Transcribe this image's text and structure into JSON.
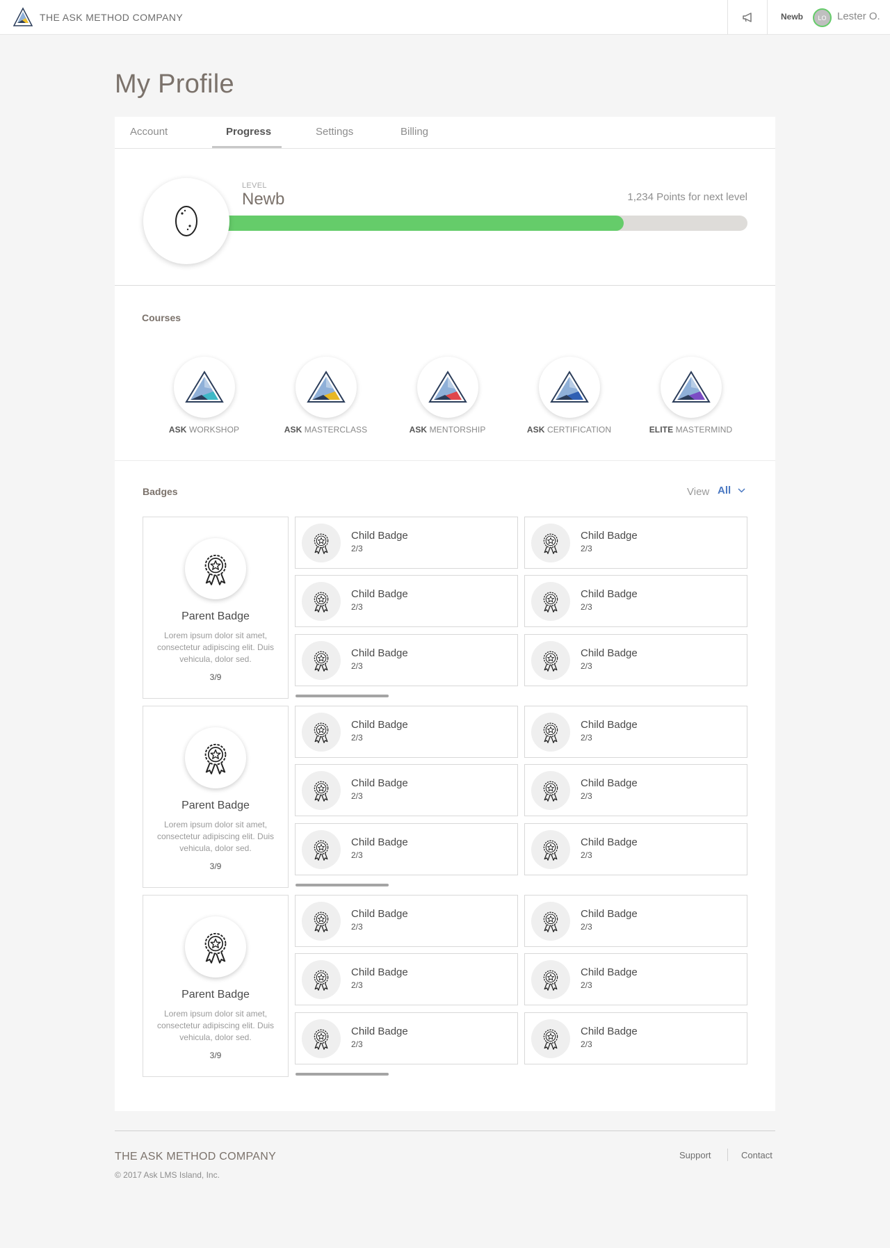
{
  "header": {
    "brand": "THE ASK METHOD COMPANY",
    "announcement_icon": "megaphone-icon",
    "user_level": "Newb",
    "avatar_initials": "LO",
    "user_name": "Lester O."
  },
  "page": {
    "title": "My Profile"
  },
  "tabs": [
    {
      "label": "Account",
      "active": false
    },
    {
      "label": "Progress",
      "active": true
    },
    {
      "label": "Settings",
      "active": false
    },
    {
      "label": "Billing",
      "active": false
    }
  ],
  "level": {
    "caption": "LEVEL",
    "name": "Newb",
    "icon": "egg-icon",
    "points_text": "1,234 Points for next level",
    "progress_fraction": 0.766
  },
  "courses": {
    "label": "Courses",
    "items": [
      {
        "prefix": "ASK",
        "name": "WORKSHOP",
        "accent": "#3fb8c6"
      },
      {
        "prefix": "ASK",
        "name": "MASTERCLASS",
        "accent": "#e8b723"
      },
      {
        "prefix": "ASK",
        "name": "MENTORSHIP",
        "accent": "#e0474c"
      },
      {
        "prefix": "ASK",
        "name": "CERTIFICATION",
        "accent": "#2f5fb3"
      },
      {
        "prefix": "ELITE",
        "name": "MASTERMIND",
        "accent": "#7b4cc4"
      }
    ]
  },
  "badges": {
    "label": "Badges",
    "view_label": "View",
    "view_value": "All",
    "groups": [
      {
        "parent": {
          "name": "Parent Badge",
          "description": "Lorem ipsum dolor sit amet, consectetur adipiscing elit. Duis vehicula, dolor sed.",
          "count": "3/9"
        },
        "children": [
          {
            "name": "Child Badge",
            "count": "2/3"
          },
          {
            "name": "Child Badge",
            "count": "2/3"
          },
          {
            "name": "Child Badge",
            "count": "2/3"
          },
          {
            "name": "Child Badge",
            "count": "2/3"
          },
          {
            "name": "Child Badge",
            "count": "2/3"
          },
          {
            "name": "Child Badge",
            "count": "2/3"
          }
        ]
      },
      {
        "parent": {
          "name": "Parent Badge",
          "description": "Lorem ipsum dolor sit amet, consectetur adipiscing elit. Duis vehicula, dolor sed.",
          "count": "3/9"
        },
        "children": [
          {
            "name": "Child Badge",
            "count": "2/3"
          },
          {
            "name": "Child Badge",
            "count": "2/3"
          },
          {
            "name": "Child Badge",
            "count": "2/3"
          },
          {
            "name": "Child Badge",
            "count": "2/3"
          },
          {
            "name": "Child Badge",
            "count": "2/3"
          },
          {
            "name": "Child Badge",
            "count": "2/3"
          }
        ]
      },
      {
        "parent": {
          "name": "Parent Badge",
          "description": "Lorem ipsum dolor sit amet, consectetur adipiscing elit. Duis vehicula, dolor sed.",
          "count": "3/9"
        },
        "children": [
          {
            "name": "Child Badge",
            "count": "2/3"
          },
          {
            "name": "Child Badge",
            "count": "2/3"
          },
          {
            "name": "Child Badge",
            "count": "2/3"
          },
          {
            "name": "Child Badge",
            "count": "2/3"
          },
          {
            "name": "Child Badge",
            "count": "2/3"
          },
          {
            "name": "Child Badge",
            "count": "2/3"
          }
        ]
      }
    ]
  },
  "footer": {
    "brand": "THE ASK METHOD COMPANY",
    "copyright": "© 2017 Ask LMS Island, Inc.",
    "links": [
      "Support",
      "Contact"
    ]
  }
}
